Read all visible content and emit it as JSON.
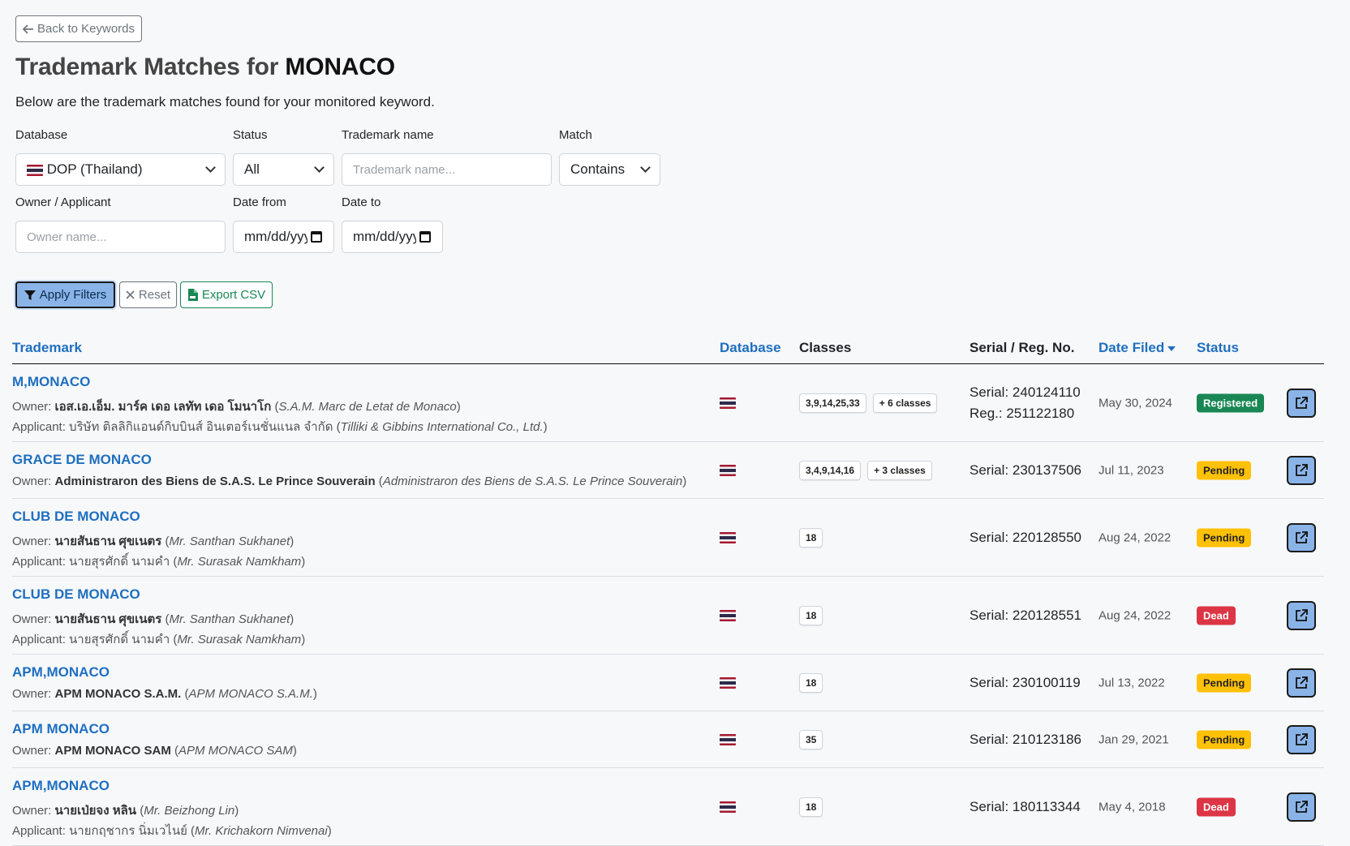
{
  "header": {
    "back_label": "Back to Keywords",
    "title_prefix": "Trademark Matches for ",
    "keyword": "MONACO",
    "subtitle": "Below are the trademark matches found for your monitored keyword."
  },
  "filters": {
    "database": {
      "label": "Database",
      "value": "DOP (Thailand)"
    },
    "status": {
      "label": "Status",
      "value": "All"
    },
    "trademark_name": {
      "label": "Trademark name",
      "placeholder": "Trademark name..."
    },
    "match": {
      "label": "Match",
      "value": "Contains"
    },
    "owner": {
      "label": "Owner / Applicant",
      "placeholder": "Owner name..."
    },
    "date_from": {
      "label": "Date from",
      "placeholder": "mm/dd/yyyy"
    },
    "date_to": {
      "label": "Date to",
      "placeholder": "mm/dd/yyyy"
    }
  },
  "actions": {
    "apply": "Apply Filters",
    "reset": "Reset",
    "export": "Export CSV"
  },
  "table": {
    "headers": {
      "trademark": "Trademark",
      "database": "Database",
      "classes": "Classes",
      "serial": "Serial / Reg. No.",
      "date_filed": "Date Filed",
      "status": "Status"
    },
    "rows": [
      {
        "name": "M,MONACO",
        "owner_label": "Owner: ",
        "owner": "เอส.เอ.เอ็ม. มาร์ค เดอ เลทัท เดอ โมนาโก",
        "owner_latin": "S.A.M. Marc de Letat de Monaco",
        "applicant_label": "Applicant: ",
        "applicant": "บริษัท ติลลิกิแอนด์กิบบินส์ อินเตอร์เนชั่นแนล จำกัด",
        "applicant_latin": "Tilliki & Gibbins International Co., Ltd.",
        "classes": [
          "3,9,14,25,33",
          "+ 6 classes"
        ],
        "serial": "Serial: 240124110",
        "reg": "Reg.: 251122180",
        "date": "May 30, 2024",
        "status": "Registered"
      },
      {
        "name": "GRACE DE MONACO",
        "owner_label": "Owner: ",
        "owner": "Administraron des Biens de S.A.S. Le Prince Souverain",
        "owner_latin": "Administraron des Biens de S.A.S. Le Prince Souverain",
        "classes": [
          "3,4,9,14,16",
          "+ 3 classes"
        ],
        "serial": "Serial: 230137506",
        "date": "Jul 11, 2023",
        "status": "Pending"
      },
      {
        "name": "CLUB DE MONACO",
        "owner_label": "Owner: ",
        "owner": "นายสันธาน ศุขเนตร",
        "owner_latin": "Mr. Santhan Sukhanet",
        "applicant_label": "Applicant: ",
        "applicant": "นายสุรศักดิ์ นามคำ",
        "applicant_latin": "Mr. Surasak Namkham",
        "classes": [
          "18"
        ],
        "serial": "Serial: 220128550",
        "date": "Aug 24, 2022",
        "status": "Pending"
      },
      {
        "name": "CLUB DE MONACO",
        "owner_label": "Owner: ",
        "owner": "นายสันธาน ศุขเนตร",
        "owner_latin": "Mr. Santhan Sukhanet",
        "applicant_label": "Applicant: ",
        "applicant": "นายสุรศักดิ์ นามคำ",
        "applicant_latin": "Mr. Surasak Namkham",
        "classes": [
          "18"
        ],
        "serial": "Serial: 220128551",
        "date": "Aug 24, 2022",
        "status": "Dead"
      },
      {
        "name": "APM,MONACO",
        "owner_label": "Owner: ",
        "owner": "APM MONACO S.A.M.",
        "owner_latin": "APM MONACO S.A.M.",
        "classes": [
          "18"
        ],
        "serial": "Serial: 230100119",
        "date": "Jul 13, 2022",
        "status": "Pending"
      },
      {
        "name": "APM MONACO",
        "owner_label": "Owner: ",
        "owner": "APM MONACO SAM",
        "owner_latin": "APM MONACO SAM",
        "classes": [
          "35"
        ],
        "serial": "Serial: 210123186",
        "date": "Jan 29, 2021",
        "status": "Pending"
      },
      {
        "name": "APM,MONACO",
        "owner_label": "Owner: ",
        "owner": "นายเป่ยจง หลิน",
        "owner_latin": "Mr. Beizhong Lin",
        "applicant_label": "Applicant: ",
        "applicant": "นายกฤชากร นิ่มเวไนย์",
        "applicant_latin": "Mr. Krichakorn Nimvenai",
        "classes": [
          "18"
        ],
        "serial": "Serial: 180113344",
        "date": "May 4, 2018",
        "status": "Dead"
      }
    ]
  },
  "colors": {
    "link": "#1f6fc0",
    "registered": "#198754",
    "pending": "#ffc107",
    "dead": "#dc3545",
    "primary_button": "#8ab4e8"
  },
  "icons": {
    "back": "arrow-left-icon",
    "apply": "filter-icon",
    "reset": "close-icon",
    "export": "csv-file-icon",
    "open": "external-link-icon",
    "database_flag": "thailand-flag-icon"
  }
}
